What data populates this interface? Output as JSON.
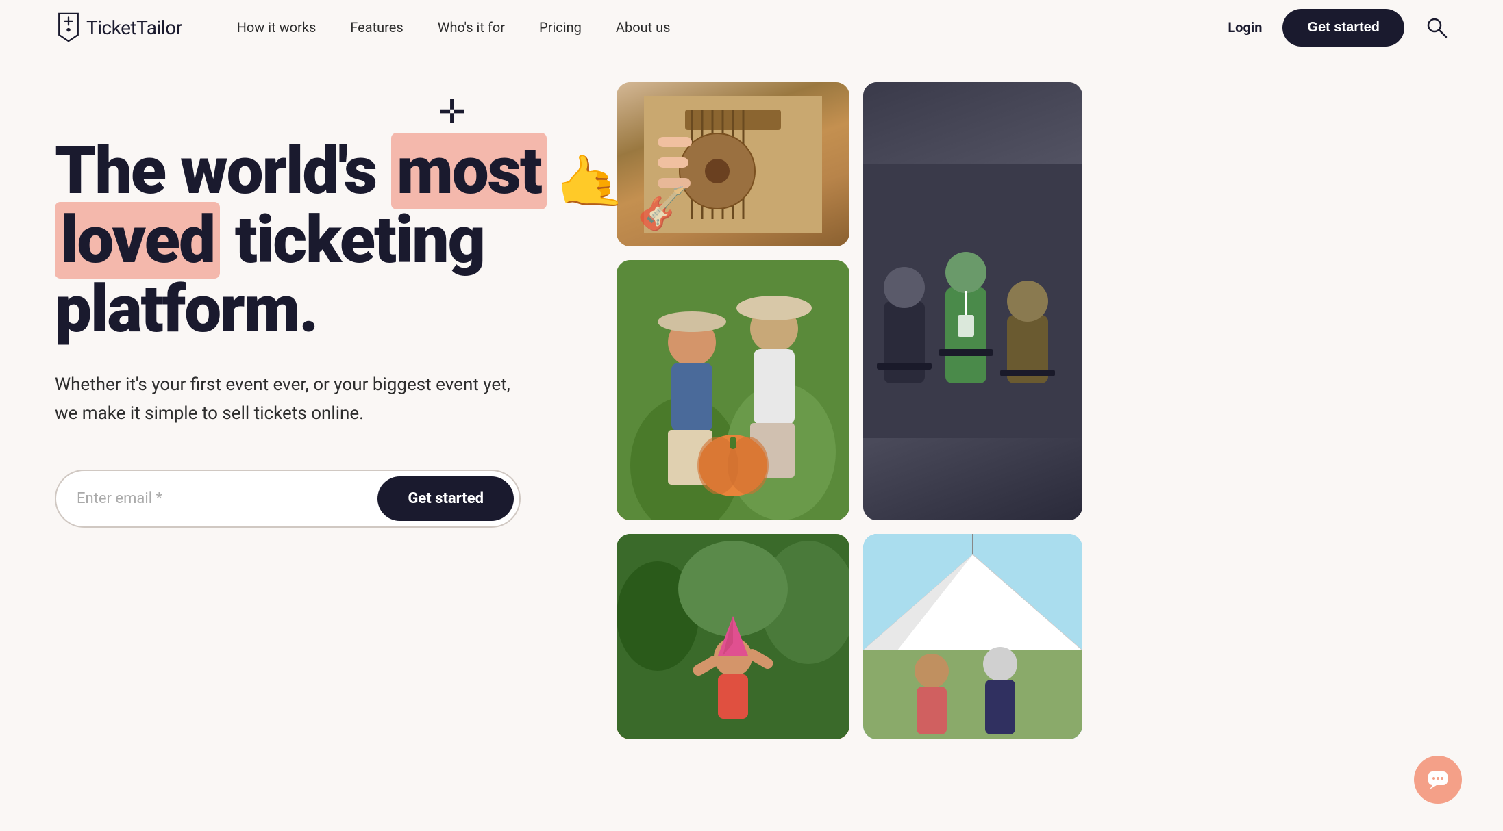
{
  "nav": {
    "logo_text_bold": "Ticket",
    "logo_text_regular": "Tailor",
    "links": [
      {
        "label": "How it works",
        "id": "how-it-works"
      },
      {
        "label": "Features",
        "id": "features"
      },
      {
        "label": "Who's it for",
        "id": "whos-it-for"
      },
      {
        "label": "Pricing",
        "id": "pricing"
      },
      {
        "label": "About us",
        "id": "about-us"
      }
    ],
    "login_label": "Login",
    "get_started_label": "Get started"
  },
  "hero": {
    "title_part1": "The world's ",
    "title_highlight1": "most",
    "title_part2": " ",
    "title_highlight2": "loved",
    "title_part3": " ticketing platform.",
    "subtitle": "Whether it's your first event ever, or your biggest event yet, we make it simple to sell tickets online.",
    "email_placeholder": "Enter email *",
    "cta_label": "Get started"
  },
  "chat": {
    "icon": "💬"
  },
  "images": [
    {
      "id": "guitar",
      "label": "Guitar player",
      "emoji": "🎸"
    },
    {
      "id": "conference",
      "label": "Conference attendees",
      "emoji": "👥"
    },
    {
      "id": "pumpkin",
      "label": "Women with pumpkin",
      "emoji": "🎃"
    },
    {
      "id": "festival",
      "label": "Festival crowd",
      "emoji": "🎪"
    },
    {
      "id": "party",
      "label": "Party",
      "emoji": "🎉"
    }
  ]
}
